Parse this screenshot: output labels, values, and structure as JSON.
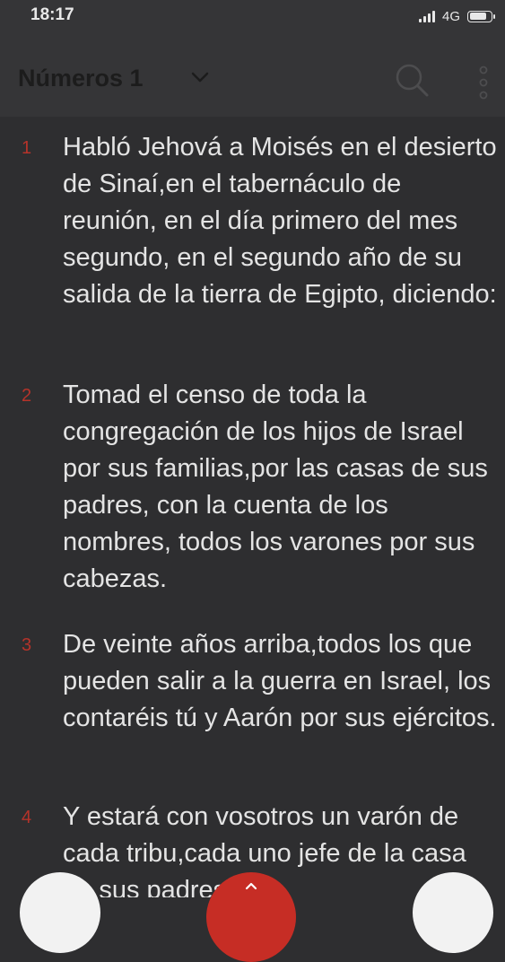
{
  "status_bar": {
    "time": "18:17",
    "network": "4G",
    "battery_level": 0.85
  },
  "header": {
    "title": "Números 1",
    "icons": {
      "dropdown": "chevron-down-icon",
      "search": "search-icon",
      "menu": "more-vertical-icon"
    }
  },
  "verses": [
    {
      "number": "1",
      "text": "Habló Jehová a Moisés en el desierto de Sinaí,en el tabernáculo de reunión, en el día primero del mes segundo, en el segundo año de su salida de la tierra de Egipto, diciendo:"
    },
    {
      "number": "2",
      "text": "Tomad el censo de toda la congregación de los hijos de Israel por sus familias,por las casas de sus padres, con la cuenta de los nombres, todos los varones por sus cabezas."
    },
    {
      "number": "3",
      "text": "De veinte años arriba,todos los que pueden salir a la guerra en Israel, los contaréis tú y Aarón por sus ejércitos."
    },
    {
      "number": "4",
      "text": "Y estará con vosotros un varón de cada tribu,cada uno jefe de la casa de sus padres."
    }
  ],
  "colors": {
    "background": "#2e2e30",
    "header": "#353537",
    "verse_number": "#b5332a",
    "accent": "#c62d25"
  }
}
